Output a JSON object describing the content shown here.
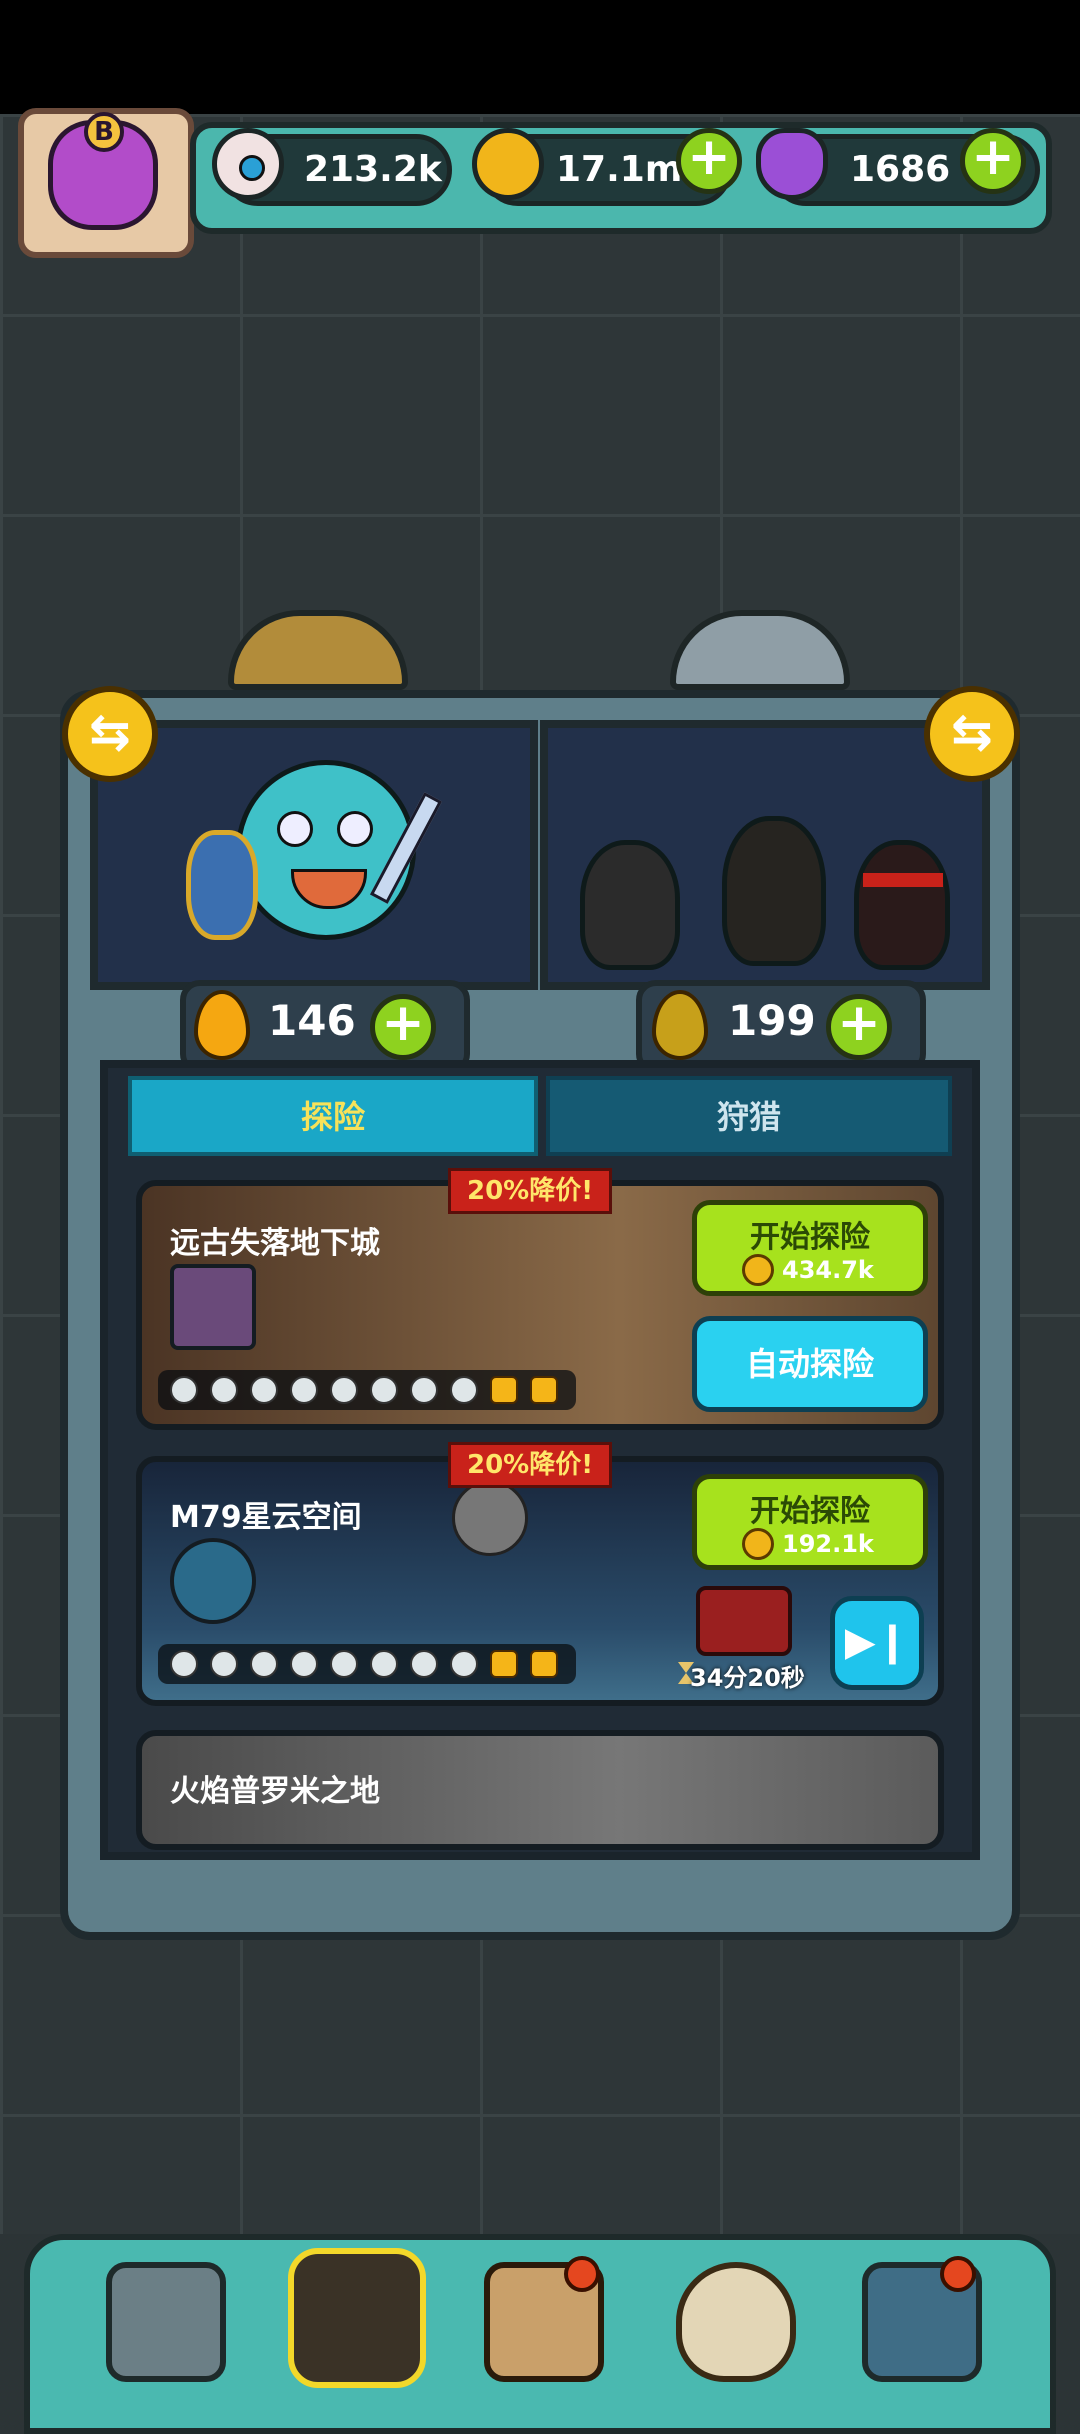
{
  "resources": {
    "eyes": "213.2k",
    "coins": "17.1m",
    "potions": "1686"
  },
  "avatar": {
    "rank_letter": "B"
  },
  "droplets": {
    "left": "146",
    "right": "199"
  },
  "tabs": [
    {
      "label": "探险",
      "active": true
    },
    {
      "label": "狩猎",
      "active": false
    }
  ],
  "dungeons": [
    {
      "name": "远古失落地下城",
      "discount": "20%降价!",
      "start_label": "开始探险",
      "cost": "434.7k",
      "auto_label": "自动探险"
    },
    {
      "name": "M79星云空间",
      "discount": "20%降价!",
      "start_label": "开始探险",
      "cost": "192.1k",
      "timer": "34分20秒"
    },
    {
      "name": "火焰普罗米之地"
    }
  ],
  "colors": {
    "accent_green": "#a7e21d",
    "accent_cyan": "#2ad1f0",
    "discount_red": "#c9221a",
    "panel_teal": "#4bb7ad"
  },
  "icons": {
    "resource_eye": "eyeball-icon",
    "resource_coin": "coin-icon",
    "resource_potion": "potion-icon",
    "swap": "swap-arrows-icon",
    "droplet": "droplet-icon",
    "skip": "skip-forward-icon",
    "hourglass": "hourglass-icon"
  }
}
